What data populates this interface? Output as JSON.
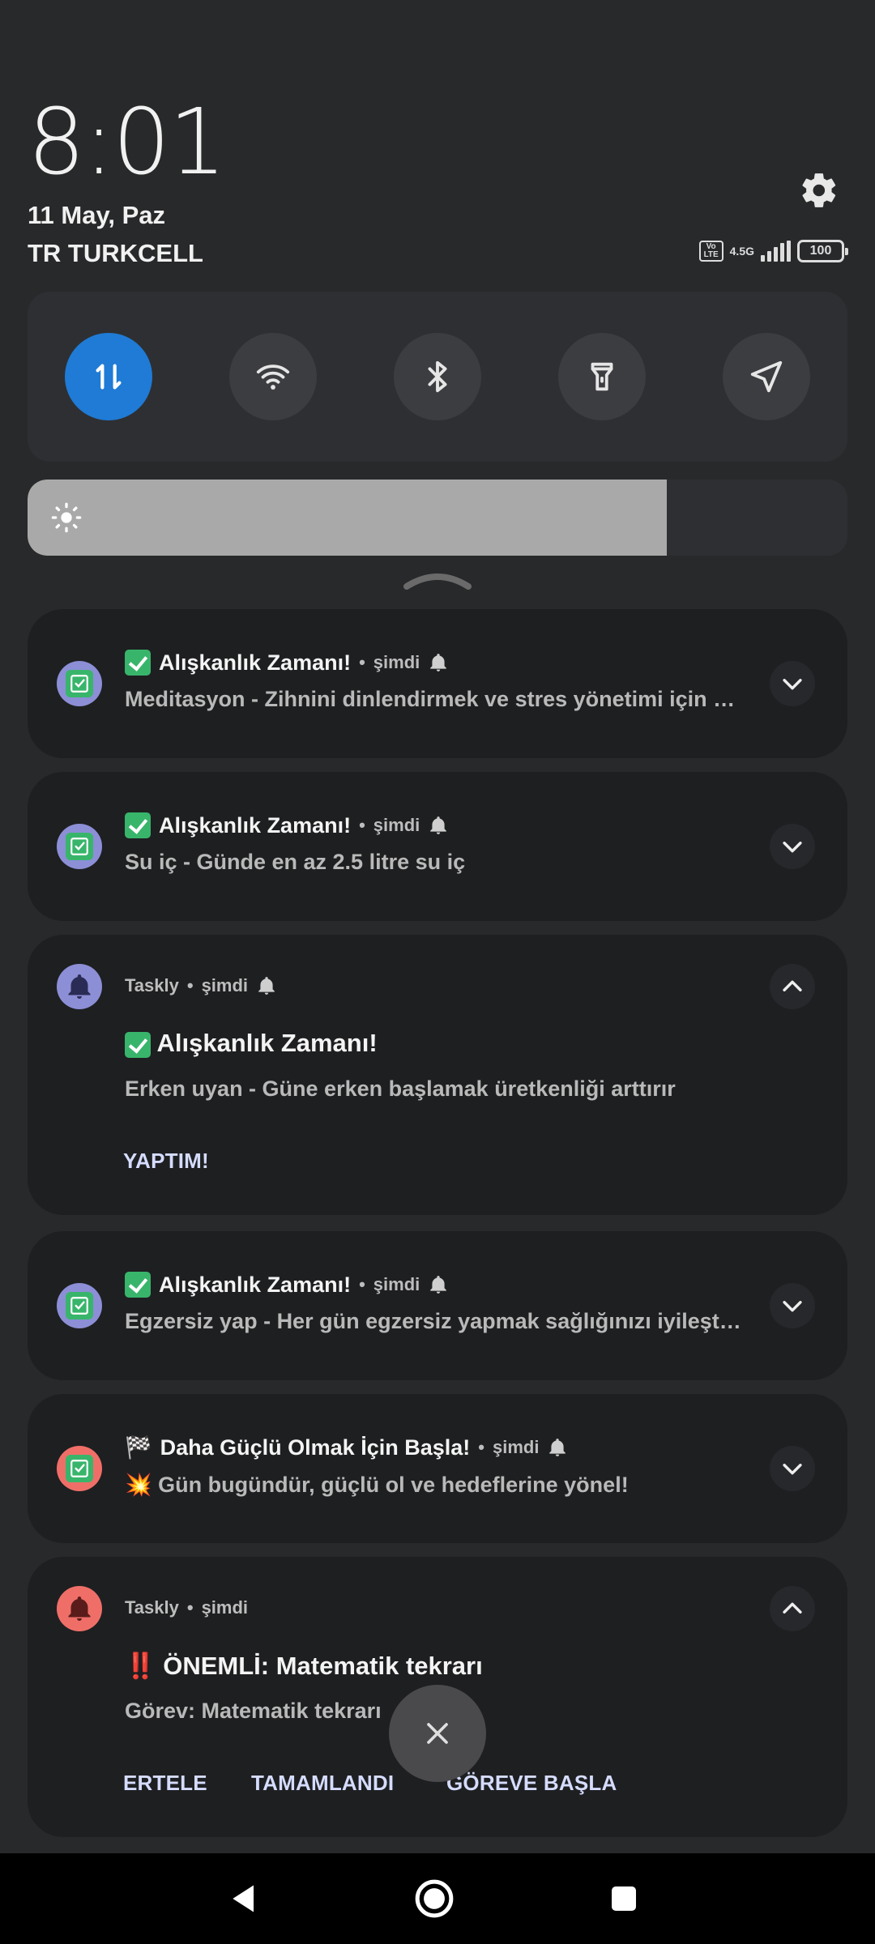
{
  "header": {
    "time": "8:01",
    "date": "11 May, Paz",
    "carrier": "TR TURKCELL",
    "status": {
      "volte": "Vo LTE",
      "network_type": "4.5G",
      "battery": "100"
    }
  },
  "quick_tiles": [
    {
      "name": "mobile-data",
      "icon": "data-arrows-icon",
      "active": true
    },
    {
      "name": "wifi",
      "icon": "wifi-icon",
      "active": false
    },
    {
      "name": "bluetooth",
      "icon": "bluetooth-icon",
      "active": false
    },
    {
      "name": "flashlight",
      "icon": "flashlight-icon",
      "active": false
    },
    {
      "name": "location",
      "icon": "location-icon",
      "active": false
    }
  ],
  "brightness": {
    "level": 0.78
  },
  "notifications": [
    {
      "app_icon": "checkbox-icon",
      "title": "Alışkanlık Zamanı!",
      "time": "şimdi",
      "body": "Meditasyon - Zihnini dinlendirmek ve stres yönetimi için her …",
      "expanded": false
    },
    {
      "app_icon": "checkbox-icon",
      "title": "Alışkanlık Zamanı!",
      "time": "şimdi",
      "body": "Su iç - Günde en az 2.5 litre su iç",
      "expanded": false
    },
    {
      "app_name": "Taskly",
      "app_icon": "bell-icon",
      "time": "şimdi",
      "title": "Alışkanlık Zamanı!",
      "body": "Erken uyan - Güne erken başlamak üretkenliği arttırır",
      "actions": [
        "YAPTIM!"
      ],
      "expanded": true
    },
    {
      "app_icon": "checkbox-icon",
      "title": "Alışkanlık Zamanı!",
      "time": "şimdi",
      "body": "Egzersiz yap - Her gün egzersiz yapmak sağlığınızı iyileştirir …",
      "expanded": false
    },
    {
      "app_icon": "checkbox-icon",
      "title_prefix": "🏁",
      "title": "Daha Güçlü Olmak İçin Başla!",
      "time": "şimdi",
      "body_prefix": "💥",
      "body": "Gün bugündür, güçlü ol ve hedeflerine yönel!",
      "expanded": false
    },
    {
      "app_name": "Taskly",
      "app_icon": "bell-icon",
      "time": "şimdi",
      "title_prefix": "‼️",
      "title": "ÖNEMLİ: Matematik tekrarı",
      "body": "Görev: Matematik tekrarı",
      "actions": [
        "ERTELE",
        "TAMAMLANDI",
        "GÖREVE BAŞLA"
      ],
      "expanded": true
    }
  ],
  "separator": "•",
  "colors": {
    "accent": "#1f7bd5",
    "icon_purple": "#8c8fd6",
    "icon_red": "#ef6f68",
    "check_green": "#38b56b",
    "action_text": "#d5dcff"
  }
}
